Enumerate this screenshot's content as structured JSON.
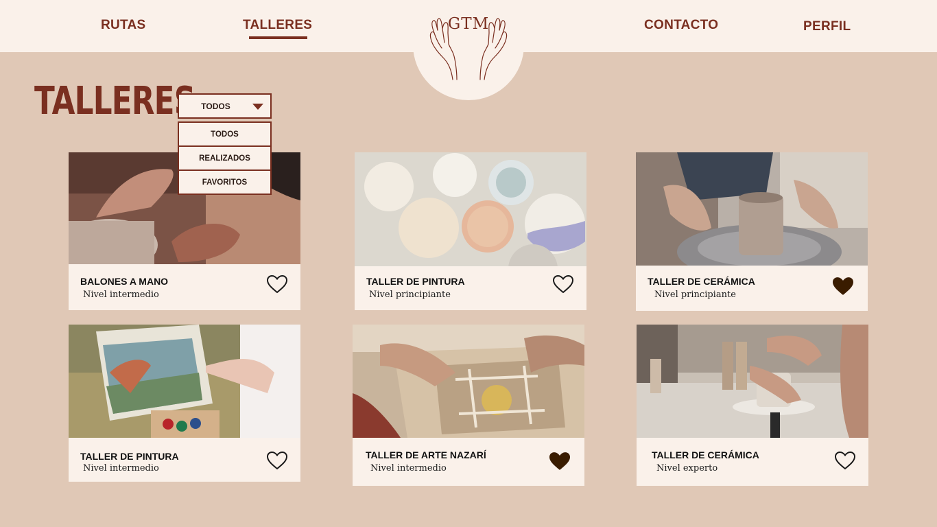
{
  "header": {
    "nav": [
      "RUTAS",
      "TALLERES",
      "CONTACTO",
      "PERFIL"
    ],
    "active": "TALLERES",
    "logo_text": "GTM"
  },
  "page": {
    "title": "TALLERES",
    "filter": {
      "selected": "TODOS",
      "options": [
        "TODOS",
        "REALIZADOS",
        "FAVORITOS"
      ]
    }
  },
  "cards": [
    {
      "title": "BALONES A MANO",
      "level": "Nivel intermedio",
      "favorite": false,
      "image": "hands-shaping-clay-photo"
    },
    {
      "title": "TALLER DE PINTURA",
      "level": "Nivel principiante",
      "favorite": false,
      "image": "painted-plates-photo"
    },
    {
      "title": "TALLER DE CERÁMICA",
      "level": "Nivel principiante",
      "favorite": true,
      "image": "pottery-wheel-photo"
    },
    {
      "title": "TALLER DE PINTURA",
      "level": "Nivel intermedio",
      "favorite": false,
      "image": "landscape-painting-easel-photo"
    },
    {
      "title": "TALLER DE ARTE NAZARÍ",
      "level": "Nivel intermedio",
      "favorite": true,
      "image": "nazari-carving-photo"
    },
    {
      "title": "TALLER DE CERÁMICA",
      "level": "Nivel experto",
      "favorite": false,
      "image": "ceramics-studio-photo"
    }
  ],
  "colors": {
    "background": "#e0c8b6",
    "surface": "#faf1ea",
    "brand": "#7a2f20",
    "heart_filled": "#3a1c00"
  }
}
